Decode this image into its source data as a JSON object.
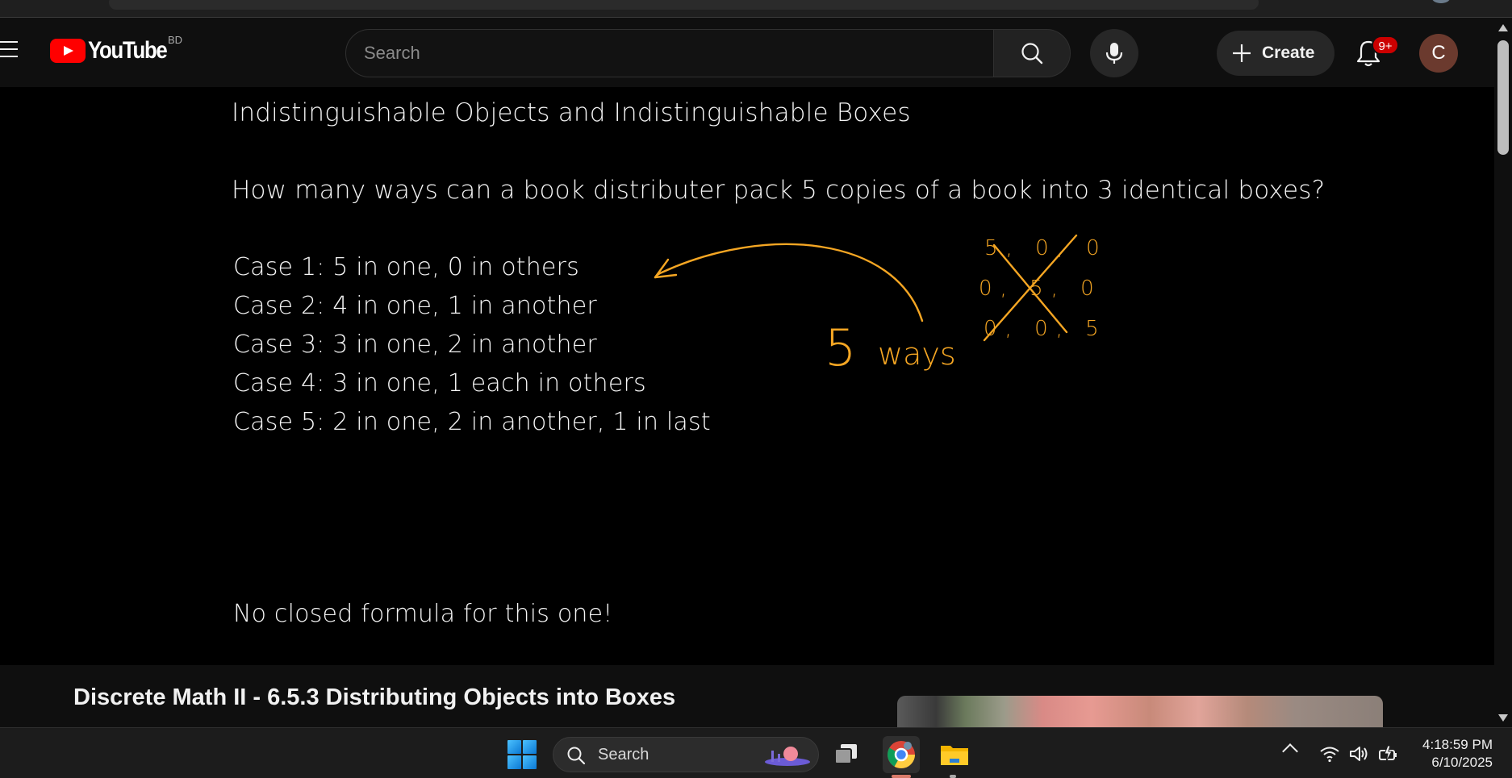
{
  "masthead": {
    "logo_text": "YouTube",
    "country_code": "BD",
    "search_placeholder": "Search",
    "create_label": "Create",
    "notification_badge": "9+",
    "avatar_initial": "C"
  },
  "video_frame": {
    "title": "Indistinguishable Objects and Indistinguishable Boxes",
    "question": "How many ways can a book distributer pack 5 copies of a book into 3 identical boxes?",
    "cases": [
      "Case 1: 5 in one, 0 in others",
      "Case 2: 4 in one, 1 in another",
      "Case 3: 3 in one, 2 in another",
      "Case 4: 3 in one, 1 each in others",
      "Case 5: 2 in one, 2 in another, 1 in last"
    ],
    "note": "No closed formula for this one!",
    "annotation": {
      "ways_label": "5 ways",
      "crossed_rows": [
        "5, 0, 0",
        "0, 5, 0",
        "0, 0, 5"
      ],
      "ink_color": "#f5a623"
    }
  },
  "below_video": {
    "video_title": "Discrete Math II - 6.5.3 Distributing Objects into Boxes"
  },
  "taskbar": {
    "search_label": "Search",
    "time": "4:18:59 PM",
    "date": "6/10/2025"
  },
  "colors": {
    "background": "#0f0f0f",
    "video_background": "#000000",
    "brand_red": "#ff0000",
    "badge_red": "#cc0000",
    "ink_orange": "#f5a623"
  }
}
